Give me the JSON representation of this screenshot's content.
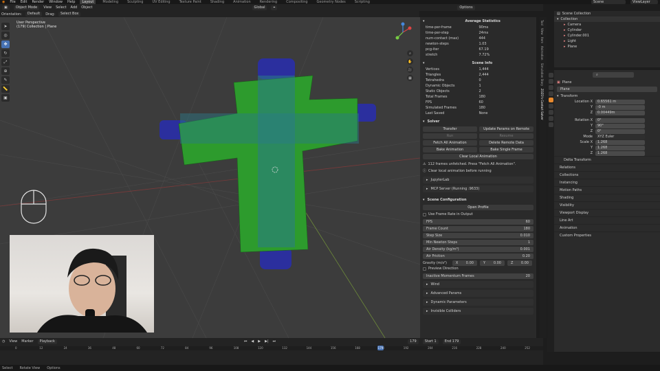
{
  "topbar": {
    "menus": [
      "File",
      "Edit",
      "Render",
      "Window",
      "Help"
    ],
    "workspaces": [
      "Layout",
      "Modeling",
      "Sculpting",
      "UV Editing",
      "Texture Paint",
      "Shading",
      "Animation",
      "Rendering",
      "Compositing",
      "Geometry Nodes",
      "Scripting"
    ],
    "active": "Layout",
    "scene": "Scene",
    "view_layer": "ViewLayer"
  },
  "header": {
    "mode": "Object Mode",
    "menus": [
      "View",
      "Select",
      "Add",
      "Object"
    ],
    "transform": "Global",
    "options": "Options"
  },
  "header2": {
    "orientation_label": "Orientation:",
    "orientation": "Default",
    "drag_label": "Drag:",
    "drag": "Select Box"
  },
  "viewport": {
    "title": "User Perspective",
    "subtitle": "(179) Collection | Plane"
  },
  "npanel": {
    "avg_title": "Average Statistics",
    "avg_stats": [
      [
        "time-per-frame",
        "90ms"
      ],
      [
        "time-per-step",
        "24ms"
      ],
      [
        "num-contact (max)",
        "444"
      ],
      [
        "newton-steps",
        "1.03"
      ],
      [
        "pcg-iter",
        "67.19"
      ],
      [
        "stretch",
        "7.72%"
      ]
    ],
    "info_title": "Scene Info",
    "info": [
      [
        "Vertices",
        "1,444"
      ],
      [
        "Triangles",
        "2,444"
      ],
      [
        "Tetrahedra",
        "0"
      ],
      [
        "Dynamic Objects",
        "1"
      ],
      [
        "Static Objects",
        "2"
      ],
      [
        "Total Frames",
        "180"
      ],
      [
        "FPS",
        "60"
      ],
      [
        "Simulated Frames",
        "180"
      ],
      [
        "Last Saved",
        "None"
      ]
    ],
    "solver_title": "Solver",
    "solver_buttons": [
      [
        "Transfer",
        "Update Params on Remote"
      ],
      [
        "Run",
        "Resume"
      ],
      [
        "Fetch All Animation",
        "Delete Remote Data"
      ],
      [
        "Bake Animation",
        "Bake Single Frame"
      ]
    ],
    "clear_local": "Clear Local Animation",
    "warn1": "112 frames unfetched. Press \"Fetch All Animation\".",
    "warn2": "Clear local animation before running",
    "jupyter": "JupyterLab",
    "mcp": "MCP Server (Running :9633)",
    "scene_cfg": "Scene Configuration",
    "open_profile": "Open Profile",
    "use_fps": "Use Frame Rate in Output",
    "fields": [
      [
        "FPS",
        "60"
      ],
      [
        "Frame Count",
        "180"
      ],
      [
        "Step Size",
        "0.010"
      ],
      [
        "Min Newton Steps",
        "1"
      ],
      [
        "Air Density (kg/m³)",
        "0.001"
      ],
      [
        "Air Friction",
        "0.20"
      ]
    ],
    "gravity_label": "Gravity (m/s²)",
    "gravity": [
      [
        "X",
        "0.00"
      ],
      [
        "Y",
        "0.00"
      ],
      [
        "Z",
        "0.00"
      ]
    ],
    "preview_dir": "Preview Direction",
    "inactive_frames": [
      "Inactive Momentum Frames",
      "20"
    ],
    "subpanels": [
      "Wind",
      "Advanced Params",
      "Dynamic Parameters",
      "Invisible Colliders"
    ]
  },
  "tabs": [
    "Tool",
    "View",
    "Item",
    "Animation",
    "Simulation Story",
    "ZOZO's Contact Solver"
  ],
  "outliner": {
    "root": "Scene Collection",
    "items": [
      "Collection",
      "Camera",
      "Cylinder",
      "Cylinder.001",
      "Light",
      "Plane"
    ]
  },
  "props": {
    "object": "Plane",
    "mesh": "Plane",
    "transform": "Transform",
    "location": [
      [
        "Location X",
        "0.65561 m"
      ],
      [
        "Y",
        "-0 m"
      ],
      [
        "Z",
        "0.00449m"
      ]
    ],
    "rotation": [
      [
        "Rotation X",
        "0°"
      ],
      [
        "Y",
        "90°"
      ],
      [
        "Z",
        "0°"
      ]
    ],
    "mode_label": "Mode",
    "mode": "XYZ Euler",
    "scale": [
      [
        "Scale X",
        "1.268"
      ],
      [
        "Y",
        "1.268"
      ],
      [
        "Z",
        "1.268"
      ]
    ],
    "delta": "Delta Transform",
    "sections": [
      "Relations",
      "Collections",
      "Instancing",
      "Motion Paths",
      "Shading",
      "Visibility",
      "Viewport Display",
      "Line Art",
      "Animation",
      "Custom Properties"
    ]
  },
  "timeline": {
    "menus": [
      "View",
      "Marker",
      "Playback"
    ],
    "current": "179",
    "start_label": "Start",
    "start": "1",
    "end_label": "End",
    "end": "179",
    "ticks": [
      "0",
      "12",
      "24",
      "36",
      "48",
      "60",
      "72",
      "84",
      "96",
      "108",
      "120",
      "132",
      "144",
      "156",
      "168",
      "180",
      "192",
      "204",
      "216",
      "228",
      "240",
      "252"
    ]
  },
  "status": [
    "Select",
    "Rotate View",
    "Options"
  ]
}
